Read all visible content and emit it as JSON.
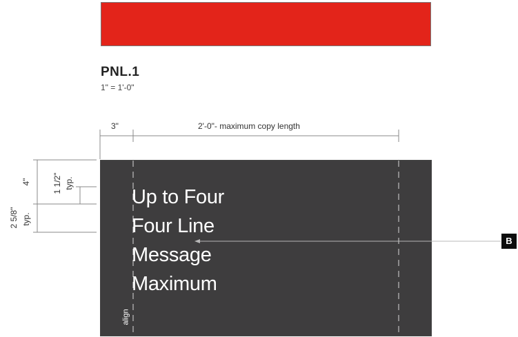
{
  "colors": {
    "sign_red": "#E3241A",
    "panel_dark": "#3e3d3e",
    "dimension_line": "#888888",
    "callout_badge": "#0d0d0d"
  },
  "title": "PNL.1",
  "scale": "1\" = 1'-0\"",
  "dimensions": {
    "margin_width": "3\"",
    "copy_length": "2'-0\"- maximum copy length",
    "top_height": "4\"",
    "line_spacing": "1 1/2\"",
    "line_spacing_typ": "typ.",
    "cap_height": "2 5/8\"",
    "cap_height_typ": "typ."
  },
  "panel": {
    "copy_lines": [
      "Up to Four",
      "Four Line",
      "Message",
      "Maximum"
    ],
    "align_label": "align"
  },
  "callout": {
    "label": "B"
  }
}
